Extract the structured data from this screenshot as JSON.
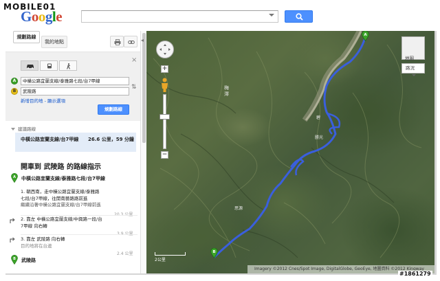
{
  "watermark": {
    "top": "MOBILE01",
    "bottom": "#1861279"
  },
  "header": {
    "logo_letters": [
      "G",
      "o",
      "o",
      "g",
      "l",
      "e"
    ],
    "search_value": ""
  },
  "panel": {
    "tab_directions": "規劃路線",
    "tab_my_maps": "我的地點",
    "origin_marker": "A",
    "origin": "中橫公路宜蘭支線/泰雅路七段/台7甲線",
    "destination_marker": "B",
    "destination": "武陵路",
    "add_destination": "新增目的地",
    "show_options": "顯示選項",
    "get_directions": "規劃路線",
    "suggested_routes": "建議路線",
    "route_name": "中橫公路宜蘭支線/台7甲線",
    "route_stats": "26.6 公里，59 分鐘",
    "heading": "開車到 武陵路 的路線指示",
    "start_address": "中橫公路宜蘭支線/泰雅路七段/台7甲線",
    "steps": [
      {
        "line1": "1. 朝西南，走中橫公路宜蘭支線/泰雅路",
        "line2": "七段/台7甲線，往開南藝路路前進",
        "line3": "繼續沿著中橫公路宜蘭支線/台7甲線前進",
        "distance": "20.3 公里"
      },
      {
        "line1": "2. 靠左 中橫公路宜蘭支線/中興路一段/台",
        "line2": "7甲線 向右轉",
        "distance": "3.9 公里"
      },
      {
        "line1": "3. 靠左 武陵路 向右轉",
        "line2": "目的地將在台邊",
        "distance": "2.4 公里"
      }
    ],
    "end_marker": "B",
    "end_address": "武陵路"
  },
  "map": {
    "type_satellite": "地圖",
    "type_roads": "路況",
    "scale_label": "2公里",
    "copyright": "Imagery ©2012 Cnes/Spot Image, DigitalGlobe, GeoEye, 地圖資料 ©2012 Kingway",
    "pin_a": "A",
    "pin_b": "B",
    "route_color": "#3a5fdd"
  }
}
